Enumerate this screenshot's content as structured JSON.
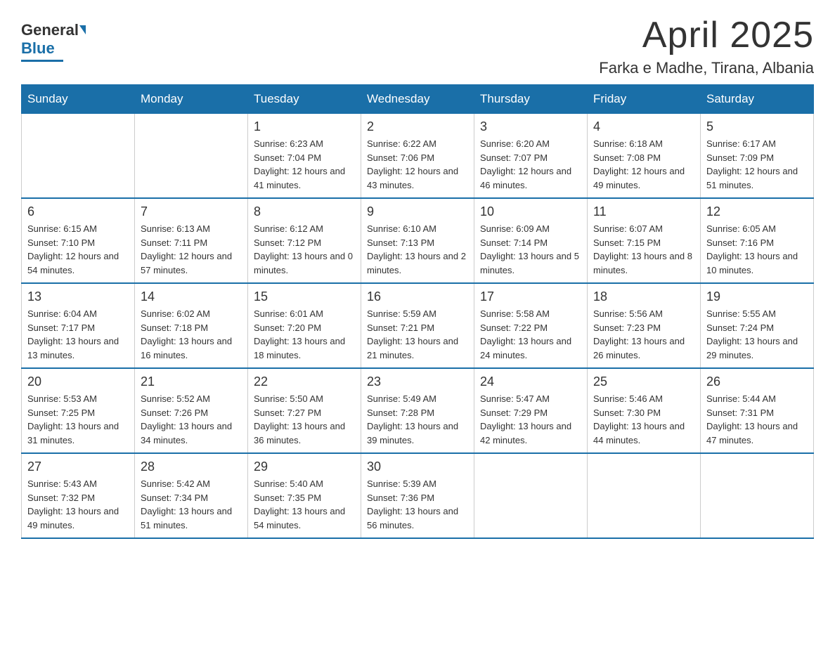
{
  "header": {
    "logo_general": "General",
    "logo_blue": "Blue",
    "main_title": "April 2025",
    "subtitle": "Farka e Madhe, Tirana, Albania"
  },
  "calendar": {
    "days": [
      "Sunday",
      "Monday",
      "Tuesday",
      "Wednesday",
      "Thursday",
      "Friday",
      "Saturday"
    ],
    "weeks": [
      [
        {
          "day": "",
          "info": ""
        },
        {
          "day": "",
          "info": ""
        },
        {
          "day": "1",
          "info": "Sunrise: 6:23 AM\nSunset: 7:04 PM\nDaylight: 12 hours\nand 41 minutes."
        },
        {
          "day": "2",
          "info": "Sunrise: 6:22 AM\nSunset: 7:06 PM\nDaylight: 12 hours\nand 43 minutes."
        },
        {
          "day": "3",
          "info": "Sunrise: 6:20 AM\nSunset: 7:07 PM\nDaylight: 12 hours\nand 46 minutes."
        },
        {
          "day": "4",
          "info": "Sunrise: 6:18 AM\nSunset: 7:08 PM\nDaylight: 12 hours\nand 49 minutes."
        },
        {
          "day": "5",
          "info": "Sunrise: 6:17 AM\nSunset: 7:09 PM\nDaylight: 12 hours\nand 51 minutes."
        }
      ],
      [
        {
          "day": "6",
          "info": "Sunrise: 6:15 AM\nSunset: 7:10 PM\nDaylight: 12 hours\nand 54 minutes."
        },
        {
          "day": "7",
          "info": "Sunrise: 6:13 AM\nSunset: 7:11 PM\nDaylight: 12 hours\nand 57 minutes."
        },
        {
          "day": "8",
          "info": "Sunrise: 6:12 AM\nSunset: 7:12 PM\nDaylight: 13 hours\nand 0 minutes."
        },
        {
          "day": "9",
          "info": "Sunrise: 6:10 AM\nSunset: 7:13 PM\nDaylight: 13 hours\nand 2 minutes."
        },
        {
          "day": "10",
          "info": "Sunrise: 6:09 AM\nSunset: 7:14 PM\nDaylight: 13 hours\nand 5 minutes."
        },
        {
          "day": "11",
          "info": "Sunrise: 6:07 AM\nSunset: 7:15 PM\nDaylight: 13 hours\nand 8 minutes."
        },
        {
          "day": "12",
          "info": "Sunrise: 6:05 AM\nSunset: 7:16 PM\nDaylight: 13 hours\nand 10 minutes."
        }
      ],
      [
        {
          "day": "13",
          "info": "Sunrise: 6:04 AM\nSunset: 7:17 PM\nDaylight: 13 hours\nand 13 minutes."
        },
        {
          "day": "14",
          "info": "Sunrise: 6:02 AM\nSunset: 7:18 PM\nDaylight: 13 hours\nand 16 minutes."
        },
        {
          "day": "15",
          "info": "Sunrise: 6:01 AM\nSunset: 7:20 PM\nDaylight: 13 hours\nand 18 minutes."
        },
        {
          "day": "16",
          "info": "Sunrise: 5:59 AM\nSunset: 7:21 PM\nDaylight: 13 hours\nand 21 minutes."
        },
        {
          "day": "17",
          "info": "Sunrise: 5:58 AM\nSunset: 7:22 PM\nDaylight: 13 hours\nand 24 minutes."
        },
        {
          "day": "18",
          "info": "Sunrise: 5:56 AM\nSunset: 7:23 PM\nDaylight: 13 hours\nand 26 minutes."
        },
        {
          "day": "19",
          "info": "Sunrise: 5:55 AM\nSunset: 7:24 PM\nDaylight: 13 hours\nand 29 minutes."
        }
      ],
      [
        {
          "day": "20",
          "info": "Sunrise: 5:53 AM\nSunset: 7:25 PM\nDaylight: 13 hours\nand 31 minutes."
        },
        {
          "day": "21",
          "info": "Sunrise: 5:52 AM\nSunset: 7:26 PM\nDaylight: 13 hours\nand 34 minutes."
        },
        {
          "day": "22",
          "info": "Sunrise: 5:50 AM\nSunset: 7:27 PM\nDaylight: 13 hours\nand 36 minutes."
        },
        {
          "day": "23",
          "info": "Sunrise: 5:49 AM\nSunset: 7:28 PM\nDaylight: 13 hours\nand 39 minutes."
        },
        {
          "day": "24",
          "info": "Sunrise: 5:47 AM\nSunset: 7:29 PM\nDaylight: 13 hours\nand 42 minutes."
        },
        {
          "day": "25",
          "info": "Sunrise: 5:46 AM\nSunset: 7:30 PM\nDaylight: 13 hours\nand 44 minutes."
        },
        {
          "day": "26",
          "info": "Sunrise: 5:44 AM\nSunset: 7:31 PM\nDaylight: 13 hours\nand 47 minutes."
        }
      ],
      [
        {
          "day": "27",
          "info": "Sunrise: 5:43 AM\nSunset: 7:32 PM\nDaylight: 13 hours\nand 49 minutes."
        },
        {
          "day": "28",
          "info": "Sunrise: 5:42 AM\nSunset: 7:34 PM\nDaylight: 13 hours\nand 51 minutes."
        },
        {
          "day": "29",
          "info": "Sunrise: 5:40 AM\nSunset: 7:35 PM\nDaylight: 13 hours\nand 54 minutes."
        },
        {
          "day": "30",
          "info": "Sunrise: 5:39 AM\nSunset: 7:36 PM\nDaylight: 13 hours\nand 56 minutes."
        },
        {
          "day": "",
          "info": ""
        },
        {
          "day": "",
          "info": ""
        },
        {
          "day": "",
          "info": ""
        }
      ]
    ]
  }
}
